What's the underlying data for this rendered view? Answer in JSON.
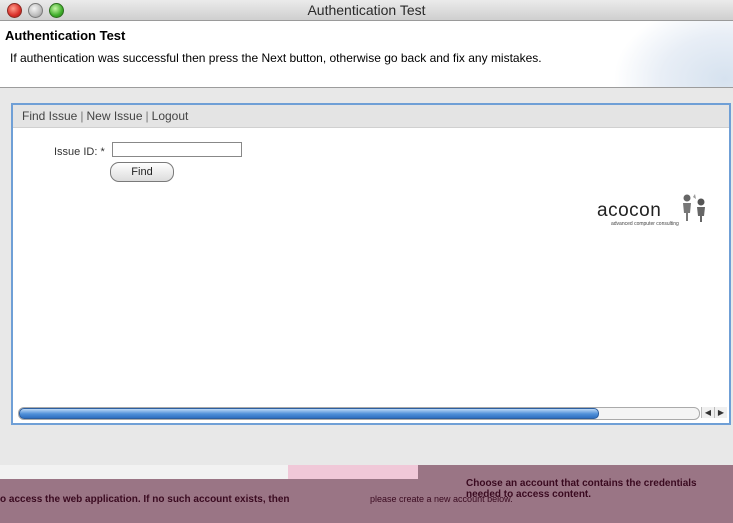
{
  "window": {
    "title": "Authentication Test"
  },
  "header": {
    "title": "Authentication Test",
    "description": "If authentication was successful then press the Next button, otherwise go back and fix any mistakes."
  },
  "nav": {
    "links": [
      "Find Issue",
      "New Issue",
      "Logout"
    ],
    "separator": "|"
  },
  "form": {
    "issue_id_label": "Issue ID: *",
    "issue_id_value": "",
    "find_label": "Find"
  },
  "logo": {
    "name": "acocon",
    "tagline": "advanced computer consulting"
  },
  "scrollbar": {
    "left_arrow": "◀",
    "right_arrow": "▶"
  },
  "bottom": {
    "hint_left": "o access the web application.  If no such account exists, then",
    "hint_middle": "please create a new account below.",
    "hint_right": "Choose an account that contains the credentials needed to access content."
  },
  "colors": {
    "panel_border": "#6f9fd6",
    "scroll_thumb": "#4f8fd8"
  }
}
